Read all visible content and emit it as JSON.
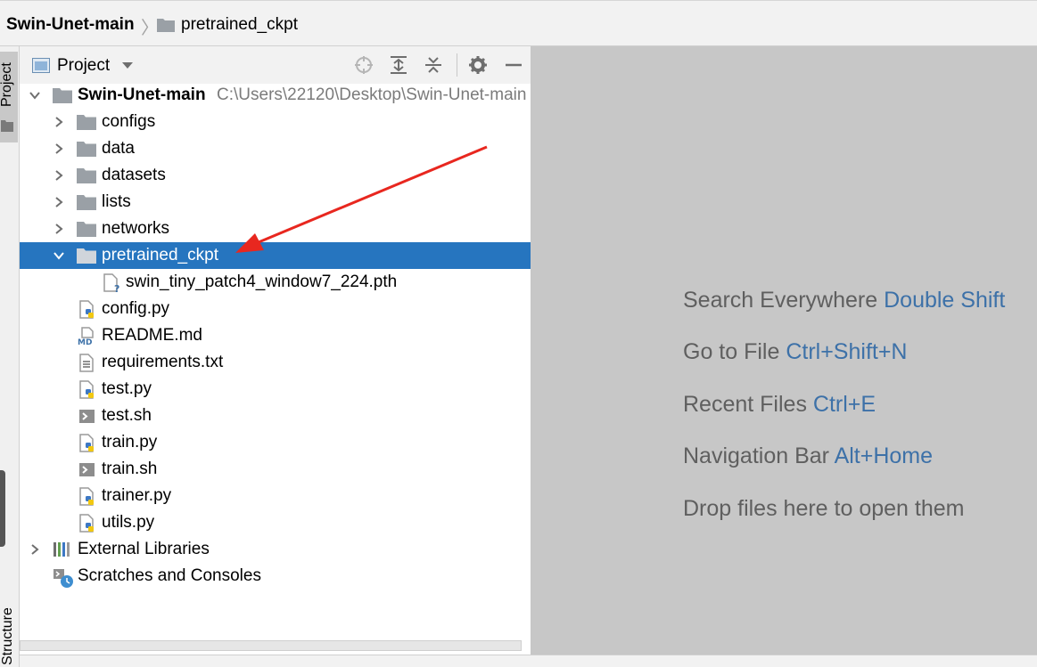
{
  "breadcrumb": {
    "root": "Swin-Unet-main",
    "child": "pretrained_ckpt"
  },
  "tool_stripe": {
    "project_label": "Project",
    "structure_label": "Structure"
  },
  "project_panel": {
    "title": "Project",
    "root": {
      "name": "Swin-Unet-main",
      "path": "C:\\Users\\22120\\Desktop\\Swin-Unet-main"
    },
    "items": [
      {
        "label": "configs",
        "type": "folder"
      },
      {
        "label": "data",
        "type": "folder"
      },
      {
        "label": "datasets",
        "type": "folder"
      },
      {
        "label": "lists",
        "type": "folder"
      },
      {
        "label": "networks",
        "type": "folder"
      },
      {
        "label": "pretrained_ckpt",
        "type": "folder",
        "expanded": true,
        "selected": true
      },
      {
        "label": "swin_tiny_patch4_window7_224.pth",
        "type": "unknown-file"
      },
      {
        "label": "config.py",
        "type": "python-file"
      },
      {
        "label": "README.md",
        "type": "markdown-file"
      },
      {
        "label": "requirements.txt",
        "type": "text-file"
      },
      {
        "label": "test.py",
        "type": "python-file"
      },
      {
        "label": "test.sh",
        "type": "shell-file"
      },
      {
        "label": "train.py",
        "type": "python-file"
      },
      {
        "label": "train.sh",
        "type": "shell-file"
      },
      {
        "label": "trainer.py",
        "type": "python-file"
      },
      {
        "label": "utils.py",
        "type": "python-file"
      }
    ],
    "external_libraries": "External Libraries",
    "scratches": "Scratches and Consoles"
  },
  "editor_hints": [
    {
      "text": "Search Everywhere",
      "key": "Double Shift"
    },
    {
      "text": "Go to File",
      "key": "Ctrl+Shift+N"
    },
    {
      "text": "Recent Files",
      "key": "Ctrl+E"
    },
    {
      "text": "Navigation Bar",
      "key": "Alt+Home"
    },
    {
      "text": "Drop files here to open them",
      "key": ""
    }
  ],
  "colors": {
    "selection": "#2675bf",
    "hint_key": "#3d71a8",
    "annotation_arrow": "#e8271f"
  }
}
